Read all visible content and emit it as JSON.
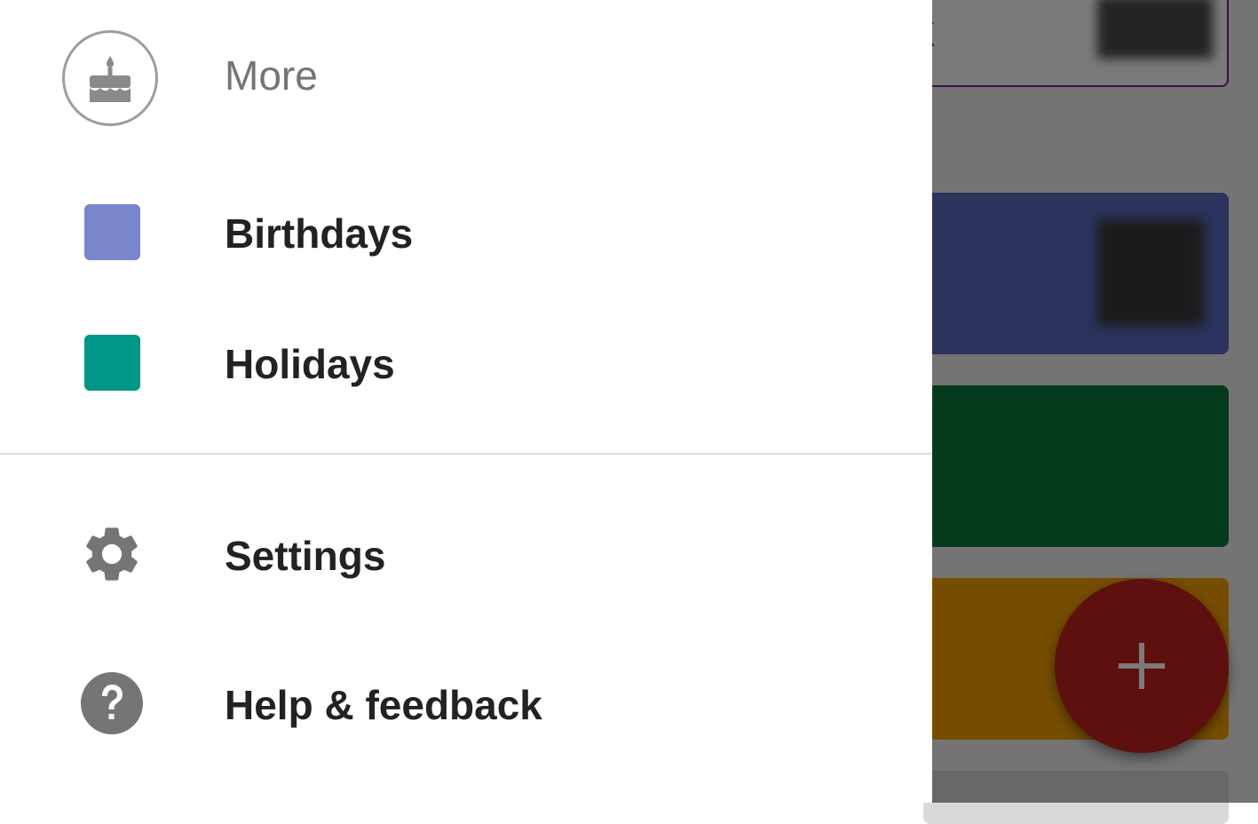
{
  "drawer": {
    "more": {
      "label": "More",
      "icon": "cake-icon"
    },
    "calendars": [
      {
        "label": "Birthdays",
        "color": "#7986cb"
      },
      {
        "label": "Holidays",
        "color": "#009688"
      }
    ],
    "settings": {
      "label": "Settings",
      "icon": "gear-icon"
    },
    "help": {
      "label": "Help & feedback",
      "icon": "help-icon"
    }
  },
  "background": {
    "card_text_partial": "nk",
    "cards": [
      {
        "color": "#5c6bc0"
      },
      {
        "color": "#0b7a3e"
      },
      {
        "color": "#f6a100"
      },
      {
        "color": "#d9d9d9"
      }
    ],
    "fab": {
      "icon": "plus-icon",
      "color": "#c5221f"
    }
  }
}
